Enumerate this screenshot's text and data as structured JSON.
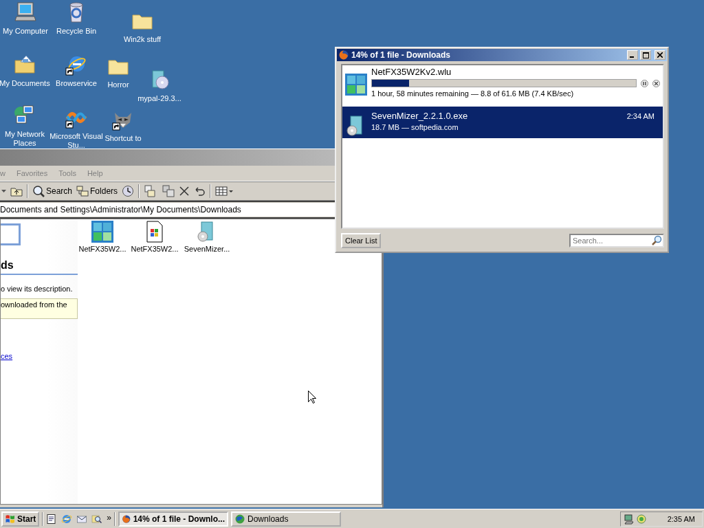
{
  "desktop_icons": [
    {
      "label": "My Computer",
      "kind": "computer",
      "shortcut": false
    },
    {
      "label": "Recycle Bin",
      "kind": "recycle",
      "shortcut": false
    },
    {
      "label": "Win2k stuff",
      "kind": "folder",
      "shortcut": false
    },
    {
      "label": "My Documents",
      "kind": "documents",
      "shortcut": false
    },
    {
      "label": "Browservice",
      "kind": "globe",
      "shortcut": true
    },
    {
      "label": "Horror",
      "kind": "folder",
      "shortcut": false
    },
    {
      "label": "mypal-29.3...",
      "kind": "installer",
      "shortcut": false
    },
    {
      "label": "My Network Places",
      "kind": "network",
      "shortcut": false
    },
    {
      "label": "Microsoft Visual Stu...",
      "kind": "ribbon",
      "shortcut": true
    },
    {
      "label": "Shortcut to",
      "kind": "raccoon",
      "shortcut": true
    }
  ],
  "explorer": {
    "menu": [
      "w",
      "Favorites",
      "Tools",
      "Help"
    ],
    "toolbar": [
      {
        "kind": "back-caret"
      },
      {
        "kind": "up"
      },
      {
        "kind": "search",
        "label": "Search"
      },
      {
        "kind": "folders",
        "label": "Folders"
      },
      {
        "kind": "history"
      },
      {
        "kind": "move"
      },
      {
        "kind": "copy"
      },
      {
        "kind": "delete"
      },
      {
        "kind": "undo"
      },
      {
        "kind": "views"
      }
    ],
    "address": "Documents and Settings\\Administrator\\My Documents\\Downloads",
    "sidebar": {
      "heading": "ds",
      "description": "o view its description.",
      "note": "ownloaded from the",
      "link": "ces"
    },
    "files": [
      {
        "label": "NetFX35W2...",
        "kind": "tiles"
      },
      {
        "label": "NetFX35W2...",
        "kind": "document"
      },
      {
        "label": "SevenMizer...",
        "kind": "installer"
      }
    ]
  },
  "downloads": {
    "title": "14% of 1 file - Downloads",
    "items": [
      {
        "kind": "active",
        "name": "NetFX35W2Kv2.wlu",
        "level": 0.14,
        "status": "1 hour, 58 minutes remaining — 8.8 of 61.6 MB (7.4 KB/sec)",
        "selected": false
      },
      {
        "kind": "done",
        "name": "SevenMizer_2.2.1.0.exe",
        "info": "18.7 MB — softpedia.com",
        "time": "2:34 AM",
        "selected": true
      }
    ],
    "clear_button": "Clear List",
    "search": {
      "placeholder": "Search..."
    }
  },
  "taskbar": {
    "start": "Start",
    "more": "»",
    "tasks": [
      {
        "label": "14% of 1 file - Downlo...",
        "selected": true
      },
      {
        "label": "Downloads",
        "selected": false
      }
    ],
    "clock": "2:35 AM"
  }
}
